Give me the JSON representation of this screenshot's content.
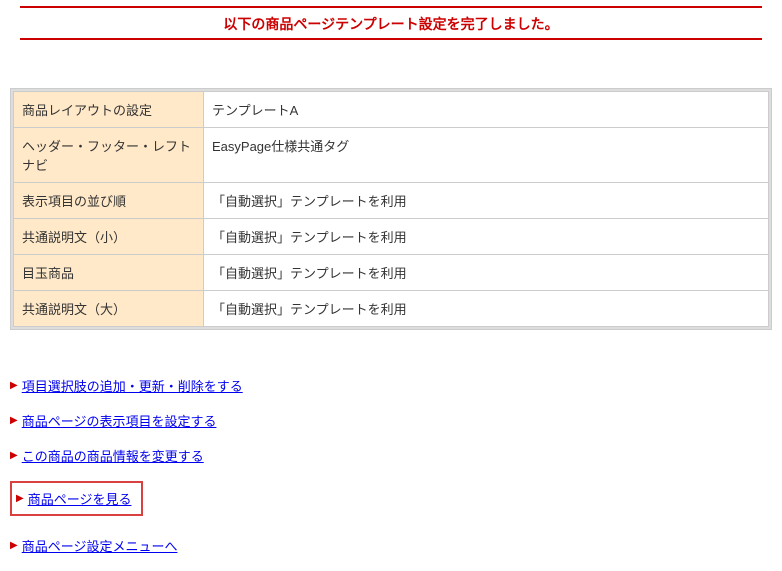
{
  "title": "以下の商品ページテンプレート設定を完了しました。",
  "table": {
    "rows": [
      {
        "label": "商品レイアウトの設定",
        "value": "テンプレートA"
      },
      {
        "label": "ヘッダー・フッター・レフトナビ",
        "value": "EasyPage仕様共通タグ"
      },
      {
        "label": "表示項目の並び順",
        "value": "「自動選択」テンプレートを利用"
      },
      {
        "label": "共通説明文（小）",
        "value": "「自動選択」テンプレートを利用"
      },
      {
        "label": "目玉商品",
        "value": "「自動選択」テンプレートを利用"
      },
      {
        "label": "共通説明文（大）",
        "value": "「自動選択」テンプレートを利用"
      }
    ]
  },
  "links": {
    "edit_choices": "項目選択肢の追加・更新・削除をする",
    "set_display": "商品ページの表示項目を設定する",
    "change_info": "この商品の商品情報を変更する",
    "view_page": "商品ページを見る",
    "settings_menu": "商品ページ設定メニューへ"
  }
}
